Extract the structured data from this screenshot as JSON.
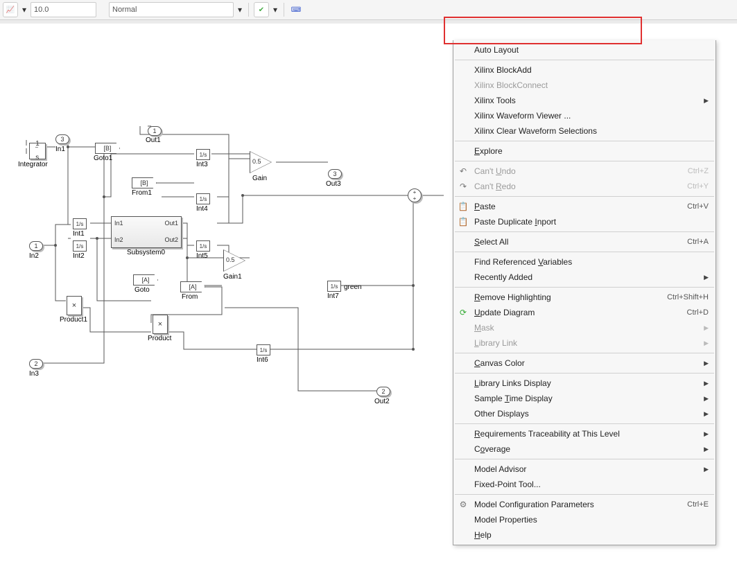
{
  "toolbar": {
    "sim_time": "10.0",
    "mode": "Normal"
  },
  "canvas": {
    "ports": {
      "in1_num": "3",
      "in1": "In1",
      "in2_num": "1",
      "in2": "In2",
      "in3_num": "2",
      "in3": "In3",
      "out1_num": "1",
      "out1": "Out1",
      "out2_num": "2",
      "out2": "Out2",
      "out3_num": "3",
      "out3": "Out3"
    },
    "blocks": {
      "integrator": {
        "text": "1/s",
        "label": "Integrator"
      },
      "int1": {
        "text": "1/s",
        "label": "Int1"
      },
      "int2": {
        "text": "1/s",
        "label": "Int2"
      },
      "int3": {
        "text": "1/s",
        "label": "Int3"
      },
      "int4": {
        "text": "1/s",
        "label": "Int4"
      },
      "int5": {
        "text": "1/s",
        "label": "Int5"
      },
      "int6": {
        "text": "1/s",
        "label": "Int6"
      },
      "int7": {
        "text": "1/s",
        "label": "Int7"
      },
      "gain": {
        "value": "0.5",
        "label": "Gain"
      },
      "gain1": {
        "value": "0.5",
        "label": "Gain1"
      },
      "goto1": {
        "tag": "[B]",
        "label": "Goto1"
      },
      "from1": {
        "tag": "[B]",
        "label": "From1"
      },
      "goto": {
        "tag": "[A]",
        "label": "Goto"
      },
      "from": {
        "tag": "[A]",
        "label": "From"
      },
      "subsystem": {
        "in1": "In1",
        "in2": "In2",
        "out1": "Out1",
        "out2": "Out2",
        "label": "Subsystem0"
      },
      "product1": {
        "label": "Product1",
        "sym": "×"
      },
      "product": {
        "label": "Product",
        "sym": "×"
      },
      "green_text": "green"
    }
  },
  "menu": {
    "auto_layout": "Auto Layout",
    "blockadd": "Xilinx BlockAdd",
    "blockconnect": "Xilinx BlockConnect",
    "xtools": "Xilinx Tools",
    "waveform": "Xilinx Waveform Viewer ...",
    "clearwave": "Xilinx Clear Waveform Selections",
    "explore": "Explore",
    "undo": "Can't Undo",
    "undo_sc": "Ctrl+Z",
    "redo": "Can't Redo",
    "redo_sc": "Ctrl+Y",
    "paste": "Paste",
    "paste_sc": "Ctrl+V",
    "paste_dup": "Paste Duplicate Inport",
    "select_all": "Select All",
    "select_all_sc": "Ctrl+A",
    "find_ref": "Find Referenced Variables",
    "recent": "Recently Added",
    "remove_hl": "Remove Highlighting",
    "remove_hl_sc": "Ctrl+Shift+H",
    "update": "Update Diagram",
    "update_sc": "Ctrl+D",
    "mask": "Mask",
    "liblink": "Library Link",
    "canvas_color": "Canvas Color",
    "liblinks_disp": "Library Links Display",
    "sample_time": "Sample Time Display",
    "other_disp": "Other Displays",
    "req_trace": "Requirements Traceability at This Level",
    "coverage": "Coverage",
    "model_advisor": "Model Advisor",
    "fixedpoint": "Fixed-Point Tool...",
    "model_cfg": "Model Configuration Parameters",
    "model_cfg_sc": "Ctrl+E",
    "model_props": "Model Properties",
    "help": "Help"
  }
}
